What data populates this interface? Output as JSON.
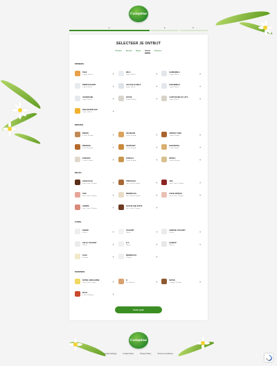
{
  "logo": {
    "text": "Campina"
  },
  "stepper": {
    "steps": [
      "1",
      "2",
      "3"
    ]
  },
  "page": {
    "title": "SELECTEER JE ONTBIJT"
  },
  "tabs": [
    {
      "label": "Drinken",
      "active": false
    },
    {
      "label": "Broods",
      "active": false
    },
    {
      "label": "Beleg",
      "active": false
    },
    {
      "label": "Zuivel",
      "active": true
    },
    {
      "label": "Diversen",
      "active": false
    }
  ],
  "sections": {
    "drinken": {
      "title": "DRINKEN",
      "items": [
        {
          "name": "THEE",
          "sub": "1 zakje, 200 ml",
          "color": "#e8a04a"
        },
        {
          "name": "MELK",
          "sub": "1 glas, 200 ml",
          "color": "#e9edf2"
        },
        {
          "name": "KARNEMELK",
          "sub": "1 glas, 200 ml",
          "color": "#e2e6ea"
        },
        {
          "name": "DRINKYOGHURT",
          "sub": "1 glas, 200 ml",
          "color": "#e7ebee"
        },
        {
          "name": "HALFVOLLE MELK",
          "sub": "1 glas, 200 ml",
          "color": "#dde3e8"
        },
        {
          "name": "KOFFIEMELK",
          "sub": "1 glas, 200 ml",
          "color": "#e4e8ec"
        },
        {
          "name": "JUSODRANK",
          "sub": "1 glas, 200 ml",
          "color": "#e5e9ee"
        },
        {
          "name": "KOFFIE",
          "sub": "1 beker, 200 ml",
          "color": "#d8d4ce"
        },
        {
          "name": "CAPPUCCINO OF LATT...",
          "sub": "1 glas, 200 ml",
          "color": "#d9d2c8"
        },
        {
          "name": "SINAASAPPELSAP",
          "sub": "1 glas, 200 ml",
          "color": "#f2b02e"
        }
      ]
    },
    "brood": {
      "title": "BROODS",
      "items": [
        {
          "name": "BROOD",
          "sub": "1 snee, 35 gram",
          "color": "#c08a55"
        },
        {
          "name": "CRACKERS",
          "sub": "1 stuk, 10 gram",
          "color": "#d9a35c"
        },
        {
          "name": "ONTBIJT KOEK",
          "sub": "1 plak, 25 gram",
          "color": "#a8642f"
        },
        {
          "name": "BROODJE",
          "sub": "1 stuk, 40 gram",
          "color": "#b46a2c"
        },
        {
          "name": "CROISSANT",
          "sub": "1 stuk, 45 gram",
          "color": "#c98a3c"
        },
        {
          "name": "RIJSTWAFEL",
          "sub": "1 stuk, 8 gram",
          "color": "#d8b070"
        },
        {
          "name": "KOEKJES",
          "sub": "1 stuk, 10 gram",
          "color": "#e0d8cc"
        },
        {
          "name": "CEREALS",
          "sub": "1 kom, 30 gram",
          "color": "#c8964e"
        },
        {
          "name": "MUESLI",
          "sub": "1 kom, 40 gram",
          "color": "#d8c090"
        }
      ]
    },
    "beleg": {
      "title": "BELEG",
      "items": [
        {
          "name": "HAGELSLAG",
          "sub": "voor 1 snee, 15 gram",
          "color": "#5b2e1a"
        },
        {
          "name": "PINDAKAAS",
          "sub": "voor 1 snee, 15 gram",
          "color": "#a86836"
        },
        {
          "name": "JAM",
          "sub": "voor 1 snee, 15 gram",
          "color": "#8c2424"
        },
        {
          "name": "HAM",
          "sub": "voor 1 snee, 15 gram",
          "color": "#e6a59a"
        },
        {
          "name": "SMEERKAAS",
          "sub": "voor 1 snee, 15 gram",
          "color": "#e9dcc8"
        },
        {
          "name": "ZUIVELSPREAD",
          "sub": "voor 1 snee, 15 gram",
          "color": "#e8c0b4"
        },
        {
          "name": "HONING",
          "sub": "voor 1 snee, 15 gram",
          "color": "#d98a7a"
        },
        {
          "name": "CHOCOLADE PASTA",
          "sub": "voor 1 snee, 15 gram",
          "color": "#6e3b22"
        }
      ]
    },
    "zuivel": {
      "title": "ZUIVEL",
      "items": [
        {
          "name": "KWARK",
          "sub": "150 ml",
          "color": "#eeeeee"
        },
        {
          "name": "YOGHURT",
          "sub": "150 ml",
          "color": "#f2f2f2"
        },
        {
          "name": "GRIEKSE YOGHURT",
          "sub": "150 ml",
          "color": "#eaeaea"
        },
        {
          "name": "VOLLE YOGHURT",
          "sub": "150 ml",
          "color": "#ececec"
        },
        {
          "name": "VLA",
          "sub": "150 ml",
          "color": "#f0f0f0"
        },
        {
          "name": "HANGOP",
          "sub": "150 ml",
          "color": "#e8e8e8"
        },
        {
          "name": "KAAS",
          "sub": "20 gram",
          "color": "#f1e9c8"
        },
        {
          "name": "SMEERKAAS",
          "sub": "20 gram",
          "color": "#eeeeee"
        }
      ]
    },
    "diversen": {
      "title": "DIVERSEN",
      "items": [
        {
          "name": "BOTER, MARGARINE",
          "sub": "voor 1 snee, 5 gram",
          "color": "#f0d860"
        },
        {
          "name": "EI",
          "sub": "1 ei, 55 gram",
          "color": "#d8a070"
        },
        {
          "name": "NOTEN",
          "sub": "1 handje, 25 gram",
          "color": "#8c5a30"
        },
        {
          "name": "FRUIT",
          "sub": "1 stuk, 100 gram",
          "color": "#c84a2c"
        }
      ]
    }
  },
  "add_symbol": "+",
  "continue_button": {
    "label": "Verder gaan"
  },
  "footer": {
    "links": [
      "Cookie Settings",
      "Cookie Policy",
      "Privacy Policy",
      "Terms & Conditions"
    ]
  },
  "colors": {
    "brand_green": "#3b8e23",
    "card_bg": "#ffffff",
    "page_bg": "#f4f4f4"
  },
  "icons": {
    "recaptcha": "recaptcha-icon",
    "flower": "daisy-icon"
  }
}
